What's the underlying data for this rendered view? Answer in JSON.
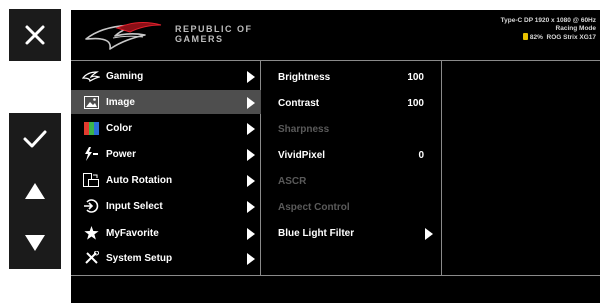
{
  "brand": {
    "line1": "REPUBLIC OF",
    "line2": "GAMERS"
  },
  "status": {
    "signal": "Type-C DP 1920 x 1080 @ 60Hz",
    "mode": "Racing Mode",
    "battery_percent": "82%",
    "model": "ROG Strix XG17",
    "battery_color": "#e8c200"
  },
  "side_buttons": [
    {
      "icon": "close-icon"
    },
    {
      "icon": "checkmark-icon"
    },
    {
      "icon": "up-triangle-icon"
    },
    {
      "icon": "down-triangle-icon"
    }
  ],
  "main_menu": [
    {
      "label": "Gaming",
      "icon": "rog-logo-icon"
    },
    {
      "label": "Image",
      "icon": "image-icon",
      "selected": true
    },
    {
      "label": "Color",
      "icon": "color-icon"
    },
    {
      "label": "Power",
      "icon": "power-icon"
    },
    {
      "label": "Auto Rotation",
      "icon": "rotation-icon"
    },
    {
      "label": "Input Select",
      "icon": "input-select-icon"
    },
    {
      "label": "MyFavorite",
      "icon": "star-icon"
    },
    {
      "label": "System Setup",
      "icon": "tools-icon"
    }
  ],
  "submenu": [
    {
      "label": "Brightness",
      "value": "100"
    },
    {
      "label": "Contrast",
      "value": "100"
    },
    {
      "label": "Sharpness",
      "disabled": true
    },
    {
      "label": "VividPixel",
      "value": "0"
    },
    {
      "label": "ASCR",
      "disabled": true
    },
    {
      "label": "Aspect Control",
      "disabled": true
    },
    {
      "label": "Blue Light Filter",
      "has_submenu": true
    }
  ],
  "colors": {
    "osd_bg": "#000000",
    "selected_row": "#4e4e4e",
    "divider": "#8a8a8a",
    "disabled_text": "#5a5a5a"
  }
}
